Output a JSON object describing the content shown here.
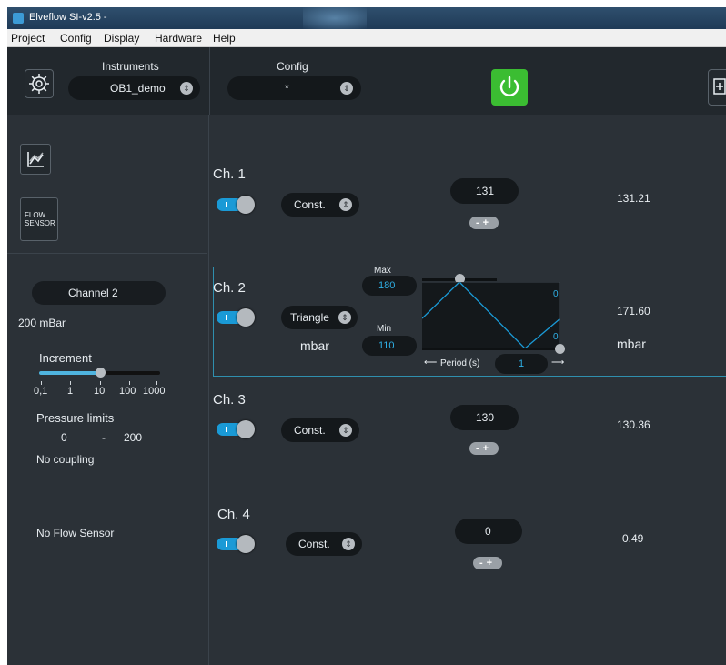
{
  "window": {
    "title": "Elveflow SI-v2.5  -"
  },
  "menu": [
    "Project",
    "Config",
    "Display",
    "Hardware",
    "Help"
  ],
  "header": {
    "instruments_label": "Instruments",
    "instrument_value": "OB1_demo",
    "config_label": "Config",
    "config_value": "*"
  },
  "sidebar": {
    "flow_sensor_label_1": "FLOW",
    "flow_sensor_label_2": "SENSOR",
    "channel_select": "Channel 2",
    "range": "200 mBar",
    "increment_label": "Increment",
    "increment_ticks": [
      "0,1",
      "1",
      "10",
      "100",
      "1000"
    ],
    "increment_selected_index": 2,
    "pressure_limits_label": "Pressure limits",
    "limit_min": "0",
    "limit_sep": "-",
    "limit_max": "200",
    "coupling": "No coupling",
    "flow_sensor_status": "No Flow Sensor"
  },
  "channels": [
    {
      "title": "Ch. 1",
      "mode": "Const.",
      "setpoint": "131",
      "reading": "131.21",
      "enabled": true
    },
    {
      "title": "Ch. 2",
      "mode": "Triangle",
      "unit_left": "mbar",
      "max_label": "Max",
      "max_value": "180",
      "min_label": "Min",
      "min_value": "110",
      "wave_top_label": "0",
      "wave_bottom_label": "0",
      "period_label": "Period (s)",
      "period_value": "1",
      "reading": "171.60",
      "unit_right": "mbar",
      "enabled": true
    },
    {
      "title": "Ch. 3",
      "mode": "Const.",
      "setpoint": "130",
      "reading": "130.36",
      "enabled": true
    },
    {
      "title": "Ch. 4",
      "mode": "Const.",
      "setpoint": "0",
      "reading": "0.49",
      "enabled": true
    }
  ],
  "stepper_text": "-+",
  "colors": {
    "accent": "#1a9ad6",
    "power": "#3bbd32",
    "background": "#2b3137",
    "panel_dark": "#22282d"
  },
  "icons": [
    "settings-gear-icon",
    "power-icon",
    "chart-icon",
    "spinner-icon",
    "left-arrow-icon",
    "right-arrow-icon"
  ]
}
